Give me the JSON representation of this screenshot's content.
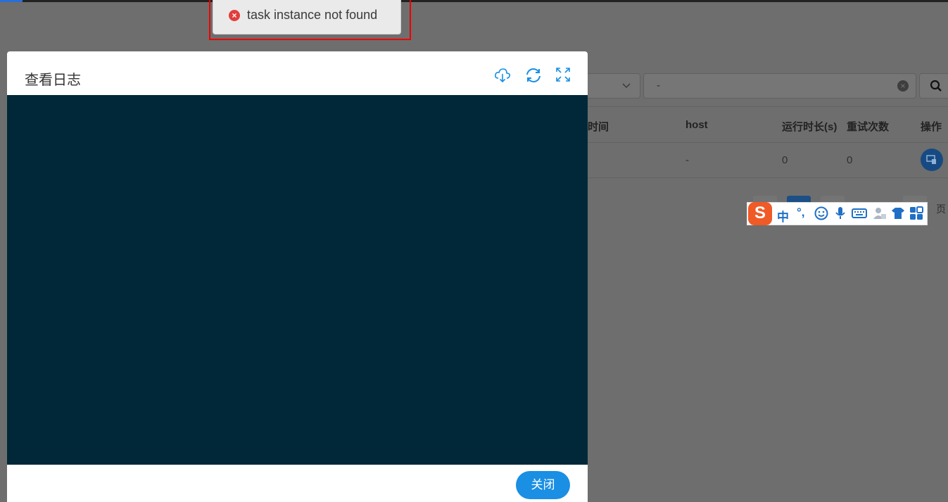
{
  "background": {
    "search_value": "-",
    "table": {
      "headers": [
        "时间",
        "host",
        "运行时长(s)",
        "重试次数",
        "操作"
      ],
      "row": [
        "-",
        "0",
        "0"
      ]
    },
    "pager_label": "页"
  },
  "ime_toolbar": {
    "logo": "S",
    "mode": "中",
    "punct": "°,"
  },
  "toast": {
    "message": "task instance not found"
  },
  "modal": {
    "title": "查看日志",
    "tools": [
      "download-icon",
      "refresh-icon",
      "fullscreen-icon"
    ],
    "close_label": "关闭"
  },
  "colors": {
    "log_background": "#002838",
    "primary": "#1a8fe3",
    "error": "#e23d3d",
    "ime_brand": "#ef5a26"
  }
}
